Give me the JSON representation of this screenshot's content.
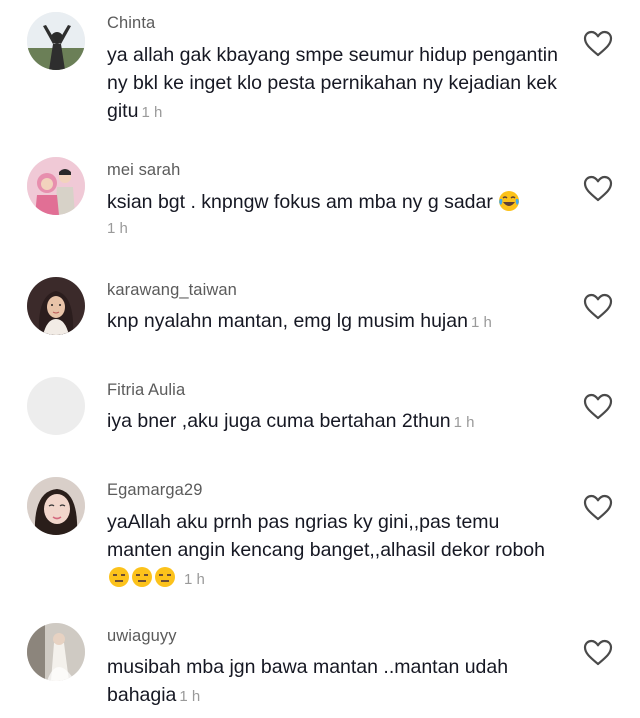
{
  "comments": [
    {
      "username": "Chinta",
      "text": "ya allah gak kbayang smpe seumur hidup pengantin ny bkl ke inget klo pesta pernikahan ny kejadian kek gitu",
      "time": "1 h"
    },
    {
      "username": "mei sarah",
      "text": "ksian bgt . knpngw fokus am mba ny g sadar",
      "emoji": "face-with-tears-of-joy",
      "time": "1 h"
    },
    {
      "username": "karawang_taiwan",
      "text": "knp nyalahn mantan, emg lg musim hujan",
      "time": "1 h"
    },
    {
      "username": "Fitria Aulia",
      "text": "iya bner ,aku juga cuma bertahan 2thun",
      "time": "1 h"
    },
    {
      "username": "Egamarga29",
      "text": "yaAllah aku prnh pas ngrias ky gini,,pas temu manten angin kencang banget,,alhasil dekor roboh",
      "emoji": "expressionless-face x3",
      "time": "1 h"
    },
    {
      "username": "uwiaguyy",
      "text": "musibah mba jgn bawa mantan ..mantan udah bahagia",
      "time": "1 h"
    }
  ],
  "icons": {
    "like": "heart-outline-icon"
  },
  "colors": {
    "username": "#5b5b5b",
    "text": "#161823",
    "time": "#9a9a9a"
  }
}
